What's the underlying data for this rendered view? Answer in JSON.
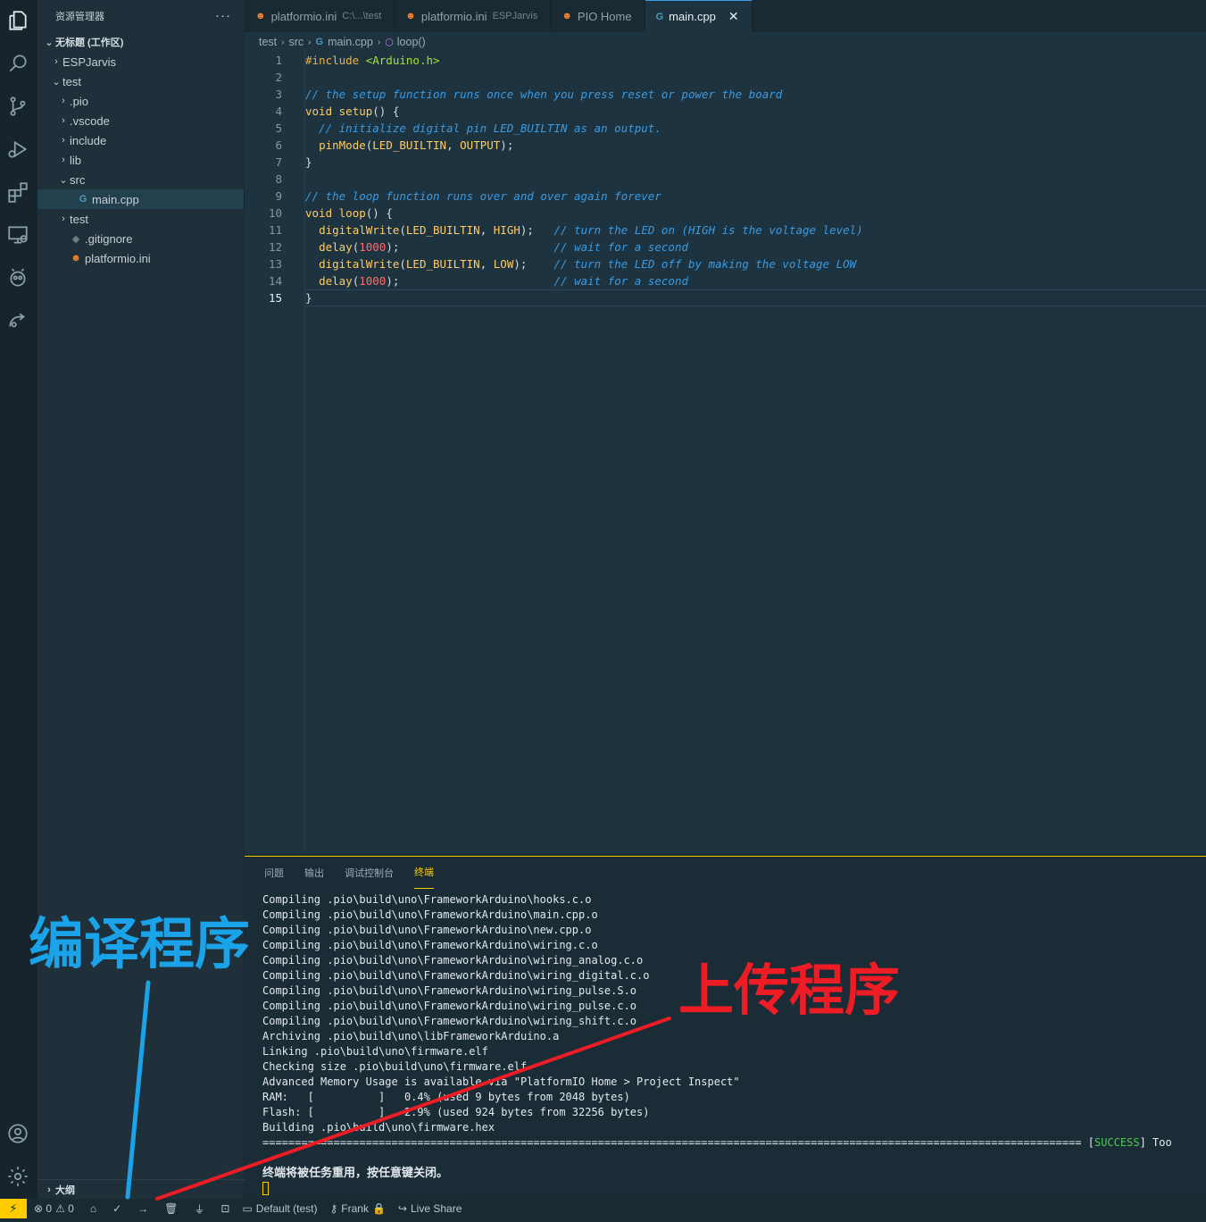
{
  "explorer": {
    "title": "资源管理器",
    "more": "···",
    "workspace": "无标题 (工作区)",
    "outline": "大纲",
    "tree": [
      {
        "label": "ESPJarvis",
        "chev": "›",
        "icon": ""
      },
      {
        "label": "test",
        "chev": "⌄",
        "icon": ""
      },
      {
        "label": ".pio",
        "chev": "›",
        "icon": ""
      },
      {
        "label": ".vscode",
        "chev": "›",
        "icon": ""
      },
      {
        "label": "include",
        "chev": "›",
        "icon": ""
      },
      {
        "label": "lib",
        "chev": "›",
        "icon": ""
      },
      {
        "label": "src",
        "chev": "⌄",
        "icon": ""
      },
      {
        "label": "main.cpp",
        "chev": "",
        "icon": "G"
      },
      {
        "label": "test",
        "chev": "›",
        "icon": ""
      },
      {
        "label": ".gitignore",
        "chev": "",
        "icon": "◆"
      },
      {
        "label": "platformio.ini",
        "chev": "",
        "icon": "☻"
      }
    ]
  },
  "tabs": [
    {
      "icon": "☻",
      "label": "platformio.ini",
      "desc": "C:\\...\\test"
    },
    {
      "icon": "☻",
      "label": "platformio.ini",
      "desc": "ESPJarvis"
    },
    {
      "icon": "☻",
      "label": "PIO Home",
      "desc": ""
    },
    {
      "icon": "G",
      "label": "main.cpp",
      "desc": "",
      "close": "✕"
    }
  ],
  "breadcrumb": {
    "p1": "test",
    "p2": "src",
    "p3": "main.cpp",
    "p4": "loop()",
    "sep": "›"
  },
  "editor": {
    "line_numbers": [
      "1",
      "2",
      "3",
      "4",
      "5",
      "6",
      "7",
      "8",
      "9",
      "10",
      "11",
      "12",
      "13",
      "14",
      "15"
    ],
    "lines": [
      [
        {
          "t": "#include ",
          "c": "pp"
        },
        {
          "t": "<Arduino.h>",
          "c": "str"
        }
      ],
      [],
      [
        {
          "t": "// the setup function runs once when you press reset or power the board",
          "c": "cm"
        }
      ],
      [
        {
          "t": "void ",
          "c": "kw"
        },
        {
          "t": "setup",
          "c": "fn"
        },
        {
          "t": "() {",
          "c": ""
        }
      ],
      [
        {
          "t": "  // initialize digital pin LED_BUILTIN as an output.",
          "c": "cm"
        }
      ],
      [
        {
          "t": "  ",
          "c": ""
        },
        {
          "t": "pinMode",
          "c": "fn"
        },
        {
          "t": "(",
          "c": ""
        },
        {
          "t": "LED_BUILTIN",
          "c": "const"
        },
        {
          "t": ", ",
          "c": ""
        },
        {
          "t": "OUTPUT",
          "c": "const"
        },
        {
          "t": ");",
          "c": ""
        }
      ],
      [
        {
          "t": "}",
          "c": ""
        }
      ],
      [],
      [
        {
          "t": "// the loop function runs over and over again forever",
          "c": "cm"
        }
      ],
      [
        {
          "t": "void ",
          "c": "kw"
        },
        {
          "t": "loop",
          "c": "fn"
        },
        {
          "t": "() {",
          "c": ""
        }
      ],
      [
        {
          "t": "  ",
          "c": ""
        },
        {
          "t": "digitalWrite",
          "c": "fn"
        },
        {
          "t": "(",
          "c": ""
        },
        {
          "t": "LED_BUILTIN",
          "c": "const"
        },
        {
          "t": ", ",
          "c": ""
        },
        {
          "t": "HIGH",
          "c": "const"
        },
        {
          "t": ");   ",
          "c": ""
        },
        {
          "t": "// turn the LED on (HIGH is the voltage level)",
          "c": "cm"
        }
      ],
      [
        {
          "t": "  ",
          "c": ""
        },
        {
          "t": "delay",
          "c": "fn"
        },
        {
          "t": "(",
          "c": ""
        },
        {
          "t": "1000",
          "c": "num"
        },
        {
          "t": ");                       ",
          "c": ""
        },
        {
          "t": "// wait for a second",
          "c": "cm"
        }
      ],
      [
        {
          "t": "  ",
          "c": ""
        },
        {
          "t": "digitalWrite",
          "c": "fn"
        },
        {
          "t": "(",
          "c": ""
        },
        {
          "t": "LED_BUILTIN",
          "c": "const"
        },
        {
          "t": ", ",
          "c": ""
        },
        {
          "t": "LOW",
          "c": "const"
        },
        {
          "t": ");    ",
          "c": ""
        },
        {
          "t": "// turn the LED off by making the voltage LOW",
          "c": "cm"
        }
      ],
      [
        {
          "t": "  ",
          "c": ""
        },
        {
          "t": "delay",
          "c": "fn"
        },
        {
          "t": "(",
          "c": ""
        },
        {
          "t": "1000",
          "c": "num"
        },
        {
          "t": ");                       ",
          "c": ""
        },
        {
          "t": "// wait for a second",
          "c": "cm"
        }
      ],
      [
        {
          "t": "}",
          "c": ""
        }
      ]
    ]
  },
  "panel": {
    "tabs": [
      "问题",
      "输出",
      "调试控制台",
      "终端"
    ],
    "terminal_lines": [
      "Compiling .pio\\build\\uno\\FrameworkArduino\\hooks.c.o",
      "Compiling .pio\\build\\uno\\FrameworkArduino\\main.cpp.o",
      "Compiling .pio\\build\\uno\\FrameworkArduino\\new.cpp.o",
      "Compiling .pio\\build\\uno\\FrameworkArduino\\wiring.c.o",
      "Compiling .pio\\build\\uno\\FrameworkArduino\\wiring_analog.c.o",
      "Compiling .pio\\build\\uno\\FrameworkArduino\\wiring_digital.c.o",
      "Compiling .pio\\build\\uno\\FrameworkArduino\\wiring_pulse.S.o",
      "Compiling .pio\\build\\uno\\FrameworkArduino\\wiring_pulse.c.o",
      "Compiling .pio\\build\\uno\\FrameworkArduino\\wiring_shift.c.o",
      "Archiving .pio\\build\\uno\\libFrameworkArduino.a",
      "Linking .pio\\build\\uno\\firmware.elf",
      "Checking size .pio\\build\\uno\\firmware.elf",
      "Advanced Memory Usage is available via \"PlatformIO Home > Project Inspect\"",
      "RAM:   [          ]   0.4% (used 9 bytes from 2048 bytes)",
      "Flash: [          ]   2.9% (used 924 bytes from 32256 bytes)",
      "Building .pio\\build\\uno\\firmware.hex"
    ],
    "separator": "=============================================================================================================================== [",
    "success": "SUCCESS",
    "after_success": "] Too",
    "reuse_msg": "终端将被任务重用，按任意键关闭。"
  },
  "statusbar": {
    "remote": "⚡",
    "errors": "⊗ 0",
    "warnings": "⚠ 0",
    "home": "⌂",
    "build": "✓",
    "upload": "→",
    "clean": "🗑",
    "serial": "⏚",
    "terminal": "⊡",
    "env": "Default (test)",
    "user": "Frank",
    "liveshare": "Live Share"
  },
  "annotations": {
    "compile": "编译程序",
    "upload": "上传程序"
  },
  "colors": {
    "accent": "#ffcc00",
    "compile_annotation": "#1aa3e8",
    "upload_annotation": "#ee1c25",
    "success": "#4ec94e"
  }
}
